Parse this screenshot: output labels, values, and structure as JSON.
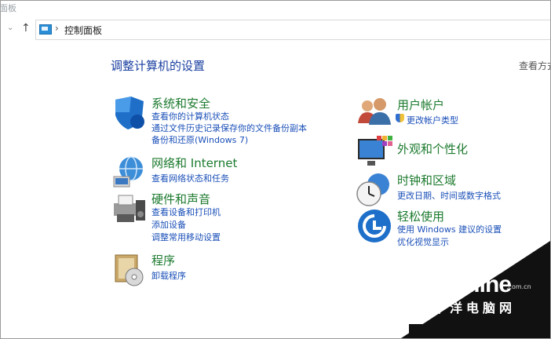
{
  "window": {
    "title_fragment": "面板"
  },
  "address": {
    "breadcrumb": "控制面板"
  },
  "main": {
    "heading": "调整计算机的设置",
    "view_by": "查看方式"
  },
  "categories": [
    {
      "id": "system-security",
      "icon": "shield-icon",
      "title": "系统和安全",
      "links": [
        "查看你的计算机状态",
        "通过文件历史记录保存你的文件备份副本",
        "备份和还原(Windows 7)"
      ]
    },
    {
      "id": "network-internet",
      "icon": "globe-network-icon",
      "title": "网络和 Internet",
      "links": [
        "查看网络状态和任务"
      ]
    },
    {
      "id": "hardware-sound",
      "icon": "printer-speaker-icon",
      "title": "硬件和声音",
      "links": [
        "查看设备和打印机",
        "添加设备",
        "调整常用移动设置"
      ]
    },
    {
      "id": "programs",
      "icon": "program-disc-icon",
      "title": "程序",
      "links": [
        "卸载程序"
      ]
    },
    {
      "id": "user-accounts",
      "icon": "users-icon",
      "title": "用户帐户",
      "links": [
        "更改帐户类型"
      ]
    },
    {
      "id": "appearance",
      "icon": "monitor-palette-icon",
      "title": "外观和个性化",
      "links": []
    },
    {
      "id": "clock-region",
      "icon": "clock-globe-icon",
      "title": "时钟和区域",
      "links": [
        "更改日期、时间或数字格式"
      ]
    },
    {
      "id": "ease-of-access",
      "icon": "accessibility-icon",
      "title": "轻松使用",
      "links": [
        "使用 Windows 建议的设置",
        "优化视觉显示"
      ]
    }
  ],
  "watermark": {
    "logo": "PConline",
    "domain": ".com.cn",
    "sub": "太平洋电脑网"
  }
}
